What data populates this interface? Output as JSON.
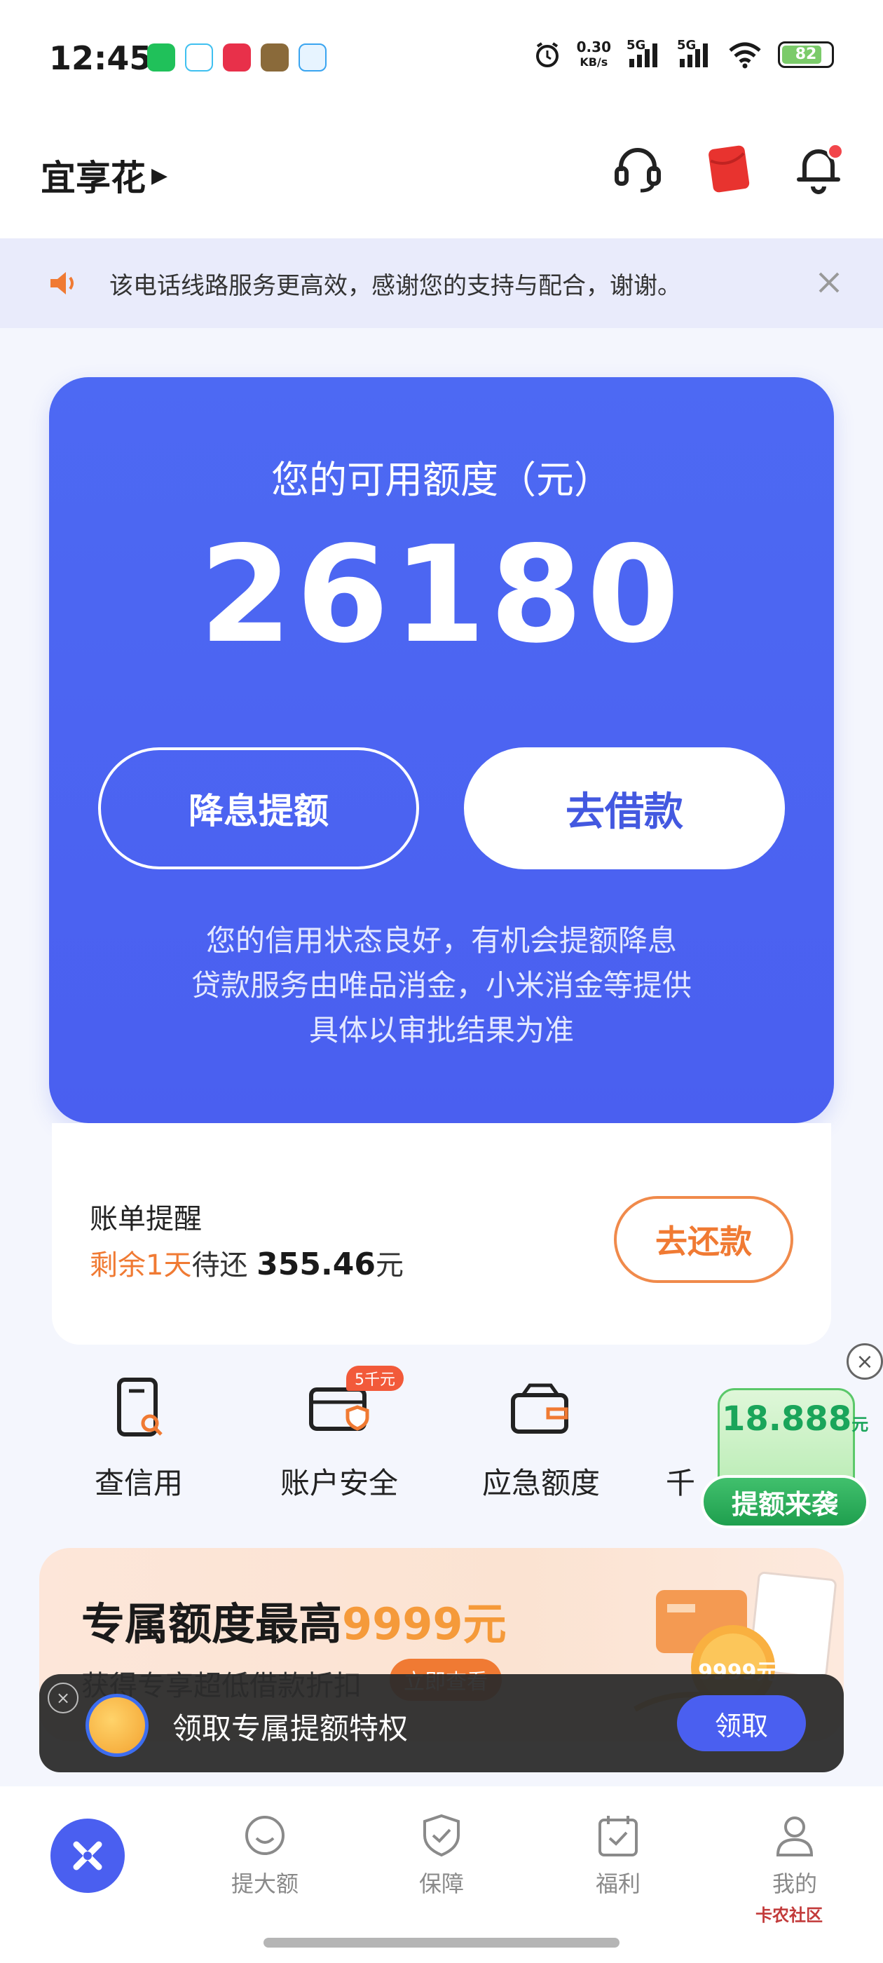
{
  "status_bar": {
    "time": "12:45",
    "net_speed_value": "0.30",
    "net_speed_unit": "KB/s",
    "sim1": "5G",
    "sim2": "5G",
    "battery": "82"
  },
  "header": {
    "title": "宜享花",
    "icons": [
      "headset-icon",
      "red-envelope-icon",
      "bell-icon"
    ]
  },
  "notice": {
    "text": "该电话线路服务更高效，感谢您的支持与配合，谢谢。"
  },
  "credit": {
    "label": "您的可用额度（元）",
    "amount": "26180",
    "raise_button": "降息提额",
    "borrow_button": "去借款",
    "desc_line1": "您的信用状态良好，有机会提额降息",
    "desc_line2": "贷款服务由唯品消金，小米消金等提供",
    "desc_line3": "具体以审批结果为准"
  },
  "bill": {
    "title": "账单提醒",
    "remain": "剩余1天",
    "pending_label": "待还",
    "amount": "355.46",
    "unit": "元",
    "repay_button": "去还款"
  },
  "quick_entries": [
    {
      "label": "查信用",
      "icon": "credit-check-icon"
    },
    {
      "label": "账户安全",
      "icon": "account-security-icon",
      "badge": "5千元"
    },
    {
      "label": "应急额度",
      "icon": "emergency-wallet-icon"
    },
    {
      "label": "千",
      "icon": "partial-icon"
    }
  ],
  "float_promo": {
    "value": "18.888",
    "unit": "元",
    "button": "提额来袭"
  },
  "banner": {
    "title_prefix": "专属额度最高",
    "title_highlight": "9999元",
    "subtitle": "获得专享超低借款折扣",
    "button": "立即查看",
    "coin_text": "9999元"
  },
  "toast": {
    "text": "领取专属提额特权",
    "button": "领取"
  },
  "bottom_nav": [
    {
      "label": "",
      "icon": "home-logo-icon"
    },
    {
      "label": "提大额",
      "icon": "smile-icon"
    },
    {
      "label": "保障",
      "icon": "shield-check-icon"
    },
    {
      "label": "福利",
      "icon": "calendar-check-icon"
    },
    {
      "label": "我的",
      "icon": "user-icon"
    }
  ],
  "watermark": "卡农社区",
  "colors": {
    "primary": "#4a5ff0",
    "accent_orange": "#f07a33",
    "promo_green": "#1aa55a"
  }
}
